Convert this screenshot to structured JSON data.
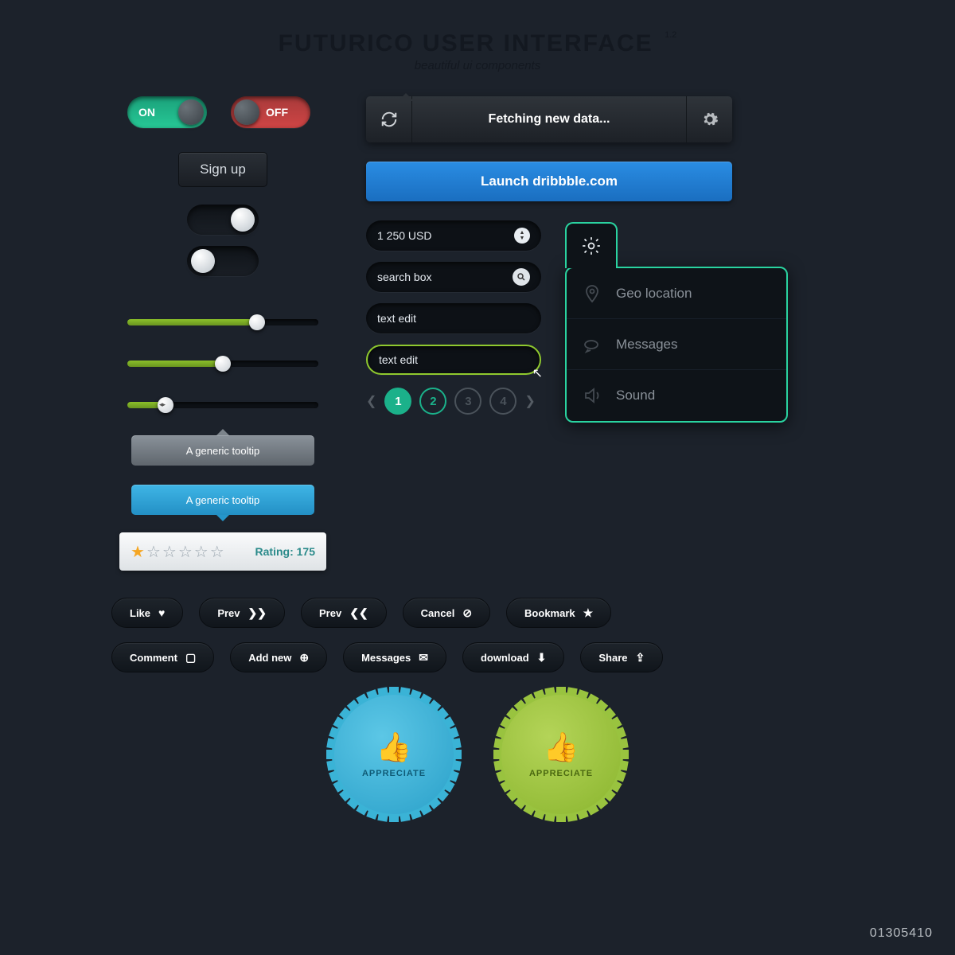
{
  "header": {
    "title": "FUTURICO USER INTERFACE",
    "version": "1.2",
    "subtitle": "beautiful ui components"
  },
  "toggles": {
    "on_label": "ON",
    "off_label": "OFF"
  },
  "signup": {
    "label": "Sign up"
  },
  "tooltips": {
    "gray": "A generic tooltip",
    "blue": "A generic tooltip"
  },
  "rating": {
    "label": "Rating: 175",
    "filled": 1,
    "total": 6
  },
  "status": {
    "text": "Fetching new data..."
  },
  "launch": {
    "label": "Launch dribbble.com"
  },
  "inputs": {
    "price": "1 250 USD",
    "search_placeholder": "search box",
    "text1": "text edit",
    "text2": "text edit"
  },
  "pagination": {
    "p1": "1",
    "p2": "2",
    "p3": "3",
    "p4": "4"
  },
  "menu": {
    "items": [
      {
        "label": "Geo location"
      },
      {
        "label": "Messages"
      },
      {
        "label": "Sound"
      }
    ]
  },
  "pill_buttons": {
    "row1": [
      {
        "label": "Like",
        "icon": "♥"
      },
      {
        "label": "Prev",
        "icon": "❯❯"
      },
      {
        "label": "Prev",
        "icon": "❮❮"
      },
      {
        "label": "Cancel",
        "icon": "⊘"
      },
      {
        "label": "Bookmark",
        "icon": "★"
      }
    ],
    "row2": [
      {
        "label": "Comment",
        "icon": "▢"
      },
      {
        "label": "Add new",
        "icon": "⊕"
      },
      {
        "label": "Messages",
        "icon": "✉"
      },
      {
        "label": "download",
        "icon": "⬇"
      },
      {
        "label": "Share",
        "icon": "⇪"
      }
    ]
  },
  "badges": {
    "text": "APPRECIATE"
  },
  "footer": {
    "code": "01305410"
  }
}
